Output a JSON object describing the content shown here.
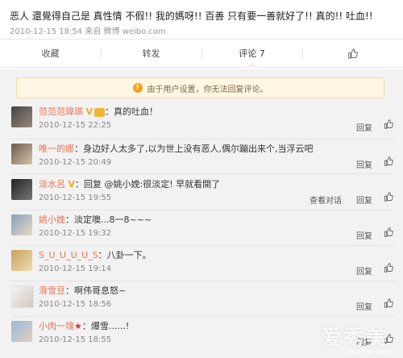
{
  "post": {
    "text": "恶人 還覺得自己是 真性情 不假!! 我的媽呀!! 百善 只有要一善就好了!! 真的!! 吐血!!",
    "meta": "2010-12-15 18:54 来自 微博 weibo.com"
  },
  "actions": {
    "favorite": "收藏",
    "repost": "转发",
    "comments": "评论 7",
    "like_icon": "thumbs-up-icon"
  },
  "notice": {
    "icon": "!",
    "text": "由于用户设置，你无法回复评论。"
  },
  "comments": [
    {
      "name": "范范范瑋琪",
      "badge": "V",
      "text": "：真的吐血！",
      "time": "2010-12-15 22:25",
      "reply": "回复"
    },
    {
      "name": "唯一的娜",
      "text": "：身边好人太多了,以为世上没有恶人,偶尔蹦出来个,当浮云吧",
      "time": "2010-12-15 20:49",
      "reply": "回复"
    },
    {
      "name": "淡水呂",
      "badge": "V",
      "text": "：回复 @姚小娩:很淡定! 早就看開了",
      "time": "2010-12-15 19:55",
      "dialog": "查看对话",
      "reply": "回复"
    },
    {
      "name": "姚小娩",
      "text": "：淡定噢...8一8~~~",
      "time": "2010-12-15 19:32",
      "reply": "回复"
    },
    {
      "name": "S_U_U_U_U_S",
      "text": "：八卦一下。",
      "time": "2010-12-15 19:14",
      "reply": "回复"
    },
    {
      "name": "滑雪豆",
      "text": "：啊伟哥息怒~",
      "time": "2010-12-15 18:56",
      "reply": "回复"
    },
    {
      "name": "小肉一塊",
      "text": "：爆雪......!",
      "time": "2010-12-15 18:55",
      "reply": "回复"
    }
  ],
  "watermark": {
    "text": "爱秀美",
    "sub": "ixiumei.com"
  }
}
